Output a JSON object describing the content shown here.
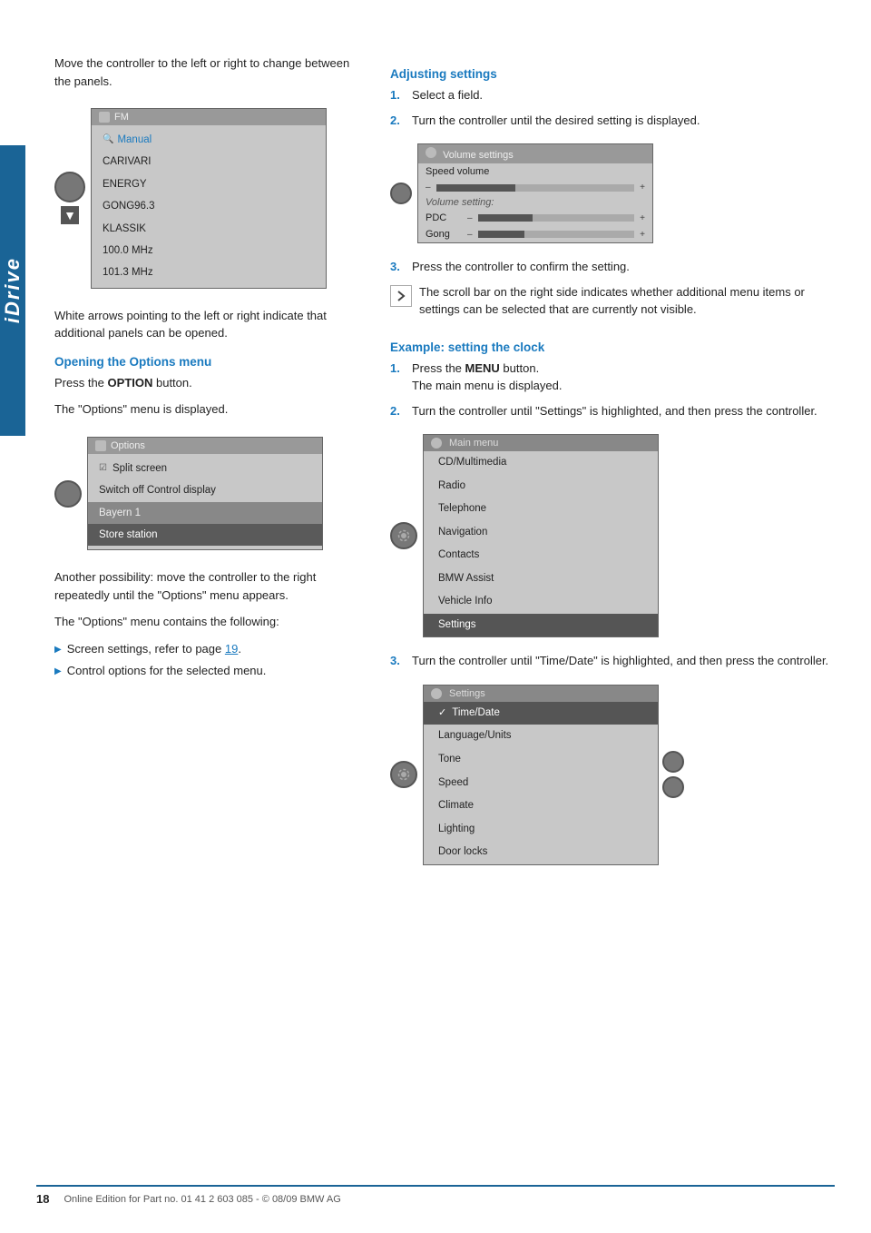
{
  "side_tab": {
    "label": "iDrive"
  },
  "left_column": {
    "intro_text": "Move the controller to the left or right to change between the panels.",
    "screen1": {
      "header": "FM",
      "items": [
        {
          "label": "Manual",
          "style": "normal"
        },
        {
          "label": "CARIVARI",
          "style": "normal"
        },
        {
          "label": "ENERGY",
          "style": "normal"
        },
        {
          "label": "GONG96.3",
          "style": "normal"
        },
        {
          "label": "KLASSIK",
          "style": "normal"
        },
        {
          "label": "100.0 MHz",
          "style": "normal"
        },
        {
          "label": "101.3 MHz",
          "style": "normal"
        }
      ]
    },
    "white_arrows_text": "White arrows pointing to the left or right indicate that additional panels can be opened.",
    "options_heading": "Opening the Options menu",
    "options_para1": "Press the OPTION button.",
    "options_para1_bold": "OPTION",
    "options_para2": "The \"Options\" menu is displayed.",
    "screen2": {
      "header": "Options",
      "items": [
        {
          "label": "Split screen",
          "style": "checkbox"
        },
        {
          "label": "Switch off Control display",
          "style": "normal"
        },
        {
          "label": "Bayern 1",
          "style": "dark"
        },
        {
          "label": "Store station",
          "style": "highlighted"
        }
      ]
    },
    "another_text": "Another possibility: move the controller to the right repeatedly until the \"Options\" menu appears.",
    "contains_text": "The \"Options\" menu contains the following:",
    "bullets": [
      {
        "text": "Screen settings, refer to page 19."
      },
      {
        "text": "Control options for the selected menu."
      }
    ],
    "bullet_link_page": "19"
  },
  "right_column": {
    "adjusting_heading": "Adjusting settings",
    "adjusting_steps": [
      {
        "num": "1.",
        "text": "Select a field."
      },
      {
        "num": "2.",
        "text": "Turn the controller until the desired setting is displayed."
      }
    ],
    "volume_screen": {
      "header": "Volume settings",
      "speed_volume_label": "Speed volume",
      "speed_bar_percent": 40,
      "volume_setting_label": "Volume setting:",
      "pdc_label": "PDC",
      "pdc_bar_percent": 35,
      "gong_label": "Gong",
      "gong_bar_percent": 30
    },
    "step3_text": "Press the controller to confirm the setting.",
    "scroll_note": "The scroll bar on the right side indicates whether additional menu items or settings can be selected that are currently not visible.",
    "example_heading": "Example: setting the clock",
    "example_steps": [
      {
        "num": "1.",
        "text": "Press the MENU button.",
        "bold": "MENU",
        "sub": "The main menu is displayed."
      },
      {
        "num": "2.",
        "text": "Turn the controller until \"Settings\" is highlighted, and then press the controller."
      }
    ],
    "main_menu_screen": {
      "header": "Main menu",
      "items": [
        {
          "label": "CD/Multimedia",
          "style": "normal"
        },
        {
          "label": "Radio",
          "style": "normal"
        },
        {
          "label": "Telephone",
          "style": "normal"
        },
        {
          "label": "Navigation",
          "style": "normal"
        },
        {
          "label": "Contacts",
          "style": "normal"
        },
        {
          "label": "BMW Assist",
          "style": "normal"
        },
        {
          "label": "Vehicle Info",
          "style": "normal"
        },
        {
          "label": "Settings",
          "style": "highlighted"
        }
      ]
    },
    "step3_settings_text": "Turn the controller until \"Time/Date\" is highlighted, and then press the controller.",
    "settings_screen": {
      "header": "Settings",
      "items": [
        {
          "label": "Time/Date",
          "style": "highlighted",
          "check": true
        },
        {
          "label": "Language/Units",
          "style": "normal"
        },
        {
          "label": "Tone",
          "style": "normal"
        },
        {
          "label": "Speed",
          "style": "normal"
        },
        {
          "label": "Climate",
          "style": "normal"
        },
        {
          "label": "Lighting",
          "style": "normal"
        },
        {
          "label": "Door locks",
          "style": "normal"
        }
      ]
    }
  },
  "footer": {
    "page_number": "18",
    "text": "Online Edition for Part no. 01 41 2 603 085 - © 08/09 BMW AG"
  }
}
